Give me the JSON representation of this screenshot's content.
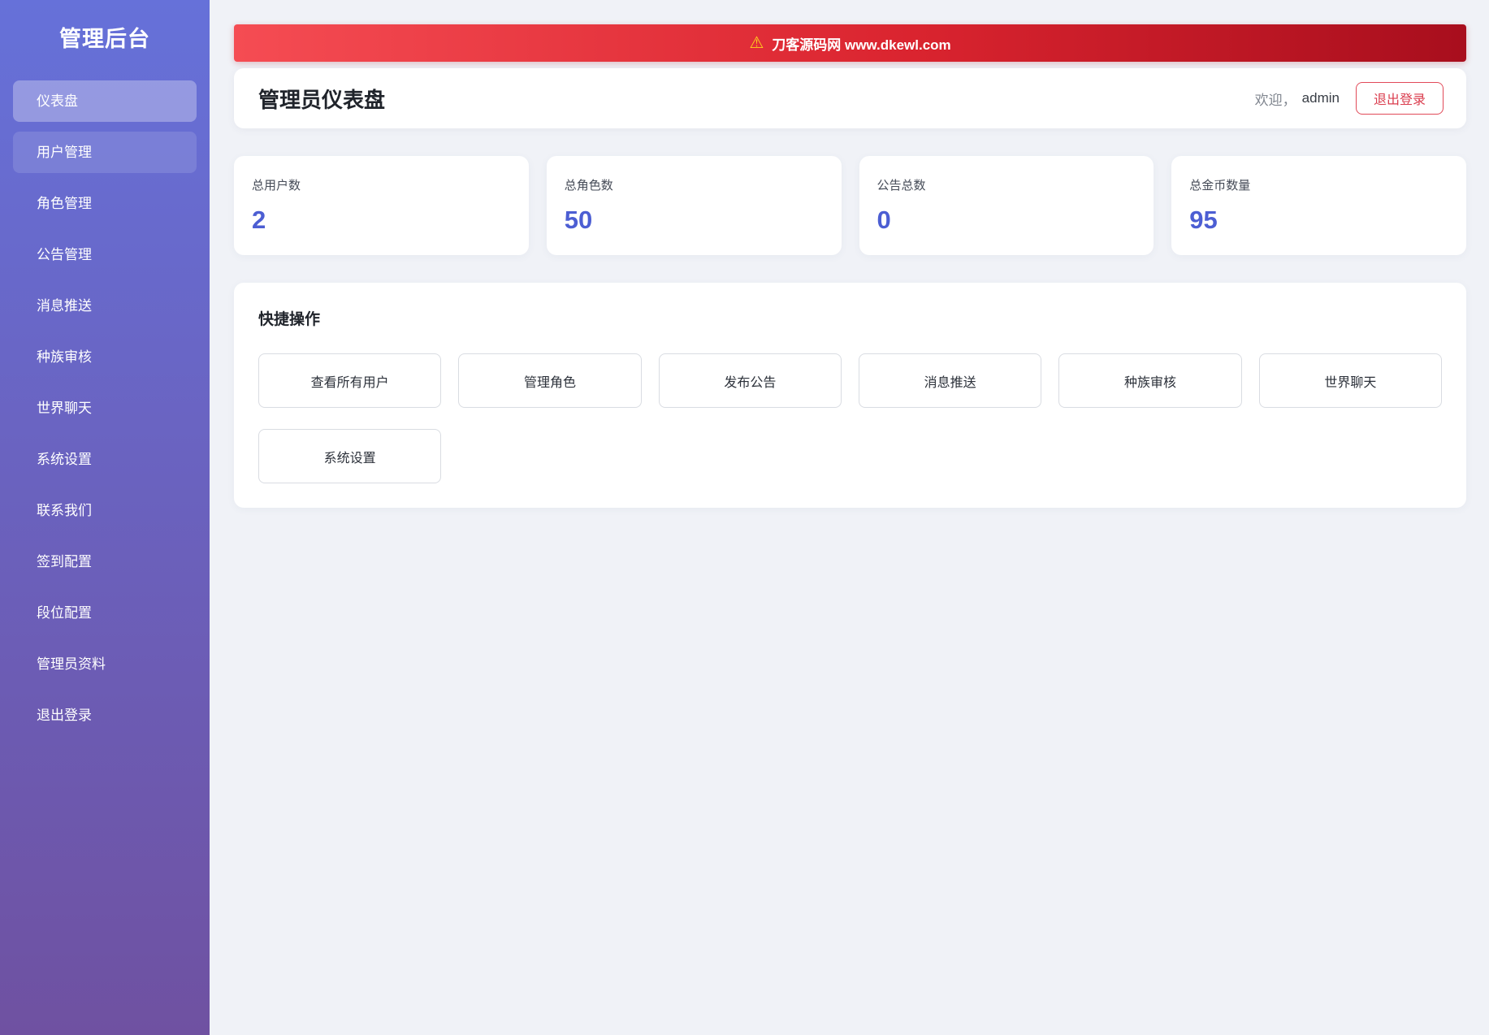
{
  "sidebar": {
    "title": "管理后台",
    "items": [
      "仪表盘",
      "用户管理",
      "角色管理",
      "公告管理",
      "消息推送",
      "种族审核",
      "世界聊天",
      "系统设置",
      "联系我们",
      "签到配置",
      "段位配置",
      "管理员资料",
      "退出登录"
    ],
    "active_item": "仪表盘"
  },
  "banner": {
    "icon": "warning-icon",
    "text": "刀客源码网 www.dkewl.com"
  },
  "header": {
    "title": "管理员仪表盘",
    "welcome_prefix": "欢迎，",
    "username": "admin",
    "logout_label": "退出登录"
  },
  "stats": [
    {
      "label": "总用户数",
      "value": "2"
    },
    {
      "label": "总角色数",
      "value": "50"
    },
    {
      "label": "公告总数",
      "value": "0"
    },
    {
      "label": "总金币数量",
      "value": "95"
    }
  ],
  "quick_actions": {
    "title": "快捷操作",
    "buttons": [
      "查看所有用户",
      "管理角色",
      "发布公告",
      "消息推送",
      "种族审核",
      "世界聊天",
      "系统设置"
    ]
  },
  "colors": {
    "sidebar_gradient_top": "#6671d9",
    "sidebar_gradient_bottom": "#6f51a1",
    "banner_red_left": "#f54c53",
    "banner_red_right": "#a80e1d",
    "warning_yellow": "#ffd21e",
    "stat_value_blue": "#4c5ed3",
    "logout_red": "#da3d4e",
    "main_background": "#f0f2f7"
  }
}
